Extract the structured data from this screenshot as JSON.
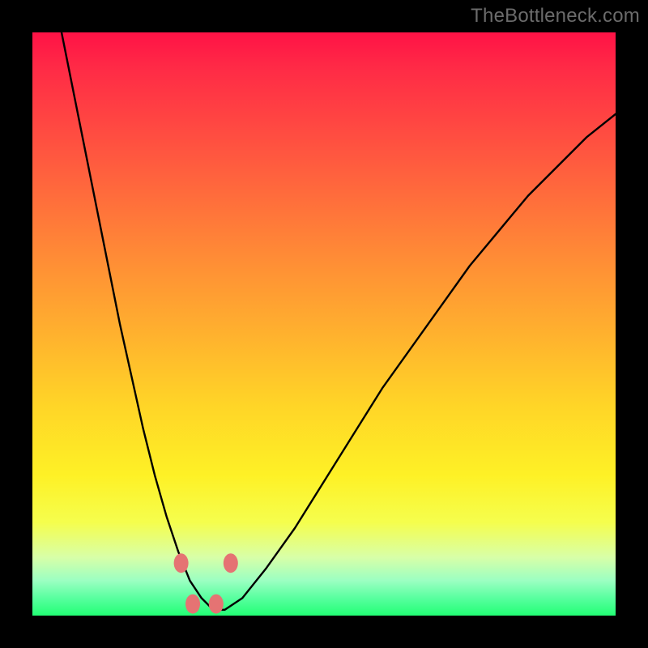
{
  "watermark": "TheBottleneck.com",
  "chart_data": {
    "type": "line",
    "title": "",
    "xlabel": "",
    "ylabel": "",
    "xlim": [
      0,
      100
    ],
    "ylim": [
      0,
      100
    ],
    "grid": false,
    "legend": false,
    "background_gradient": {
      "top": "#ff1246",
      "bottom": "#22ff74",
      "stops": [
        {
          "pct": 0,
          "color": "#ff1246"
        },
        {
          "pct": 22,
          "color": "#ff5a3f"
        },
        {
          "pct": 52,
          "color": "#ffb22e"
        },
        {
          "pct": 76,
          "color": "#fef126"
        },
        {
          "pct": 90,
          "color": "#d8ffa8"
        },
        {
          "pct": 100,
          "color": "#22ff74"
        }
      ]
    },
    "series": [
      {
        "name": "bottleneck-curve",
        "x": [
          5,
          7,
          9,
          11,
          13,
          15,
          17,
          19,
          21,
          23,
          25,
          27,
          29,
          31,
          33,
          36,
          40,
          45,
          50,
          55,
          60,
          65,
          70,
          75,
          80,
          85,
          90,
          95,
          100
        ],
        "values": [
          100,
          90,
          80,
          70,
          60,
          50,
          41,
          32,
          24,
          17,
          11,
          6,
          3,
          1,
          1,
          3,
          8,
          15,
          23,
          31,
          39,
          46,
          53,
          60,
          66,
          72,
          77,
          82,
          86
        ]
      }
    ],
    "markers": {
      "name": "highlight-dots",
      "color": "#e57373",
      "points": [
        {
          "x": 25.5,
          "y": 9
        },
        {
          "x": 27.5,
          "y": 2
        },
        {
          "x": 31.5,
          "y": 2
        },
        {
          "x": 34.0,
          "y": 9
        }
      ]
    },
    "annotations": []
  }
}
